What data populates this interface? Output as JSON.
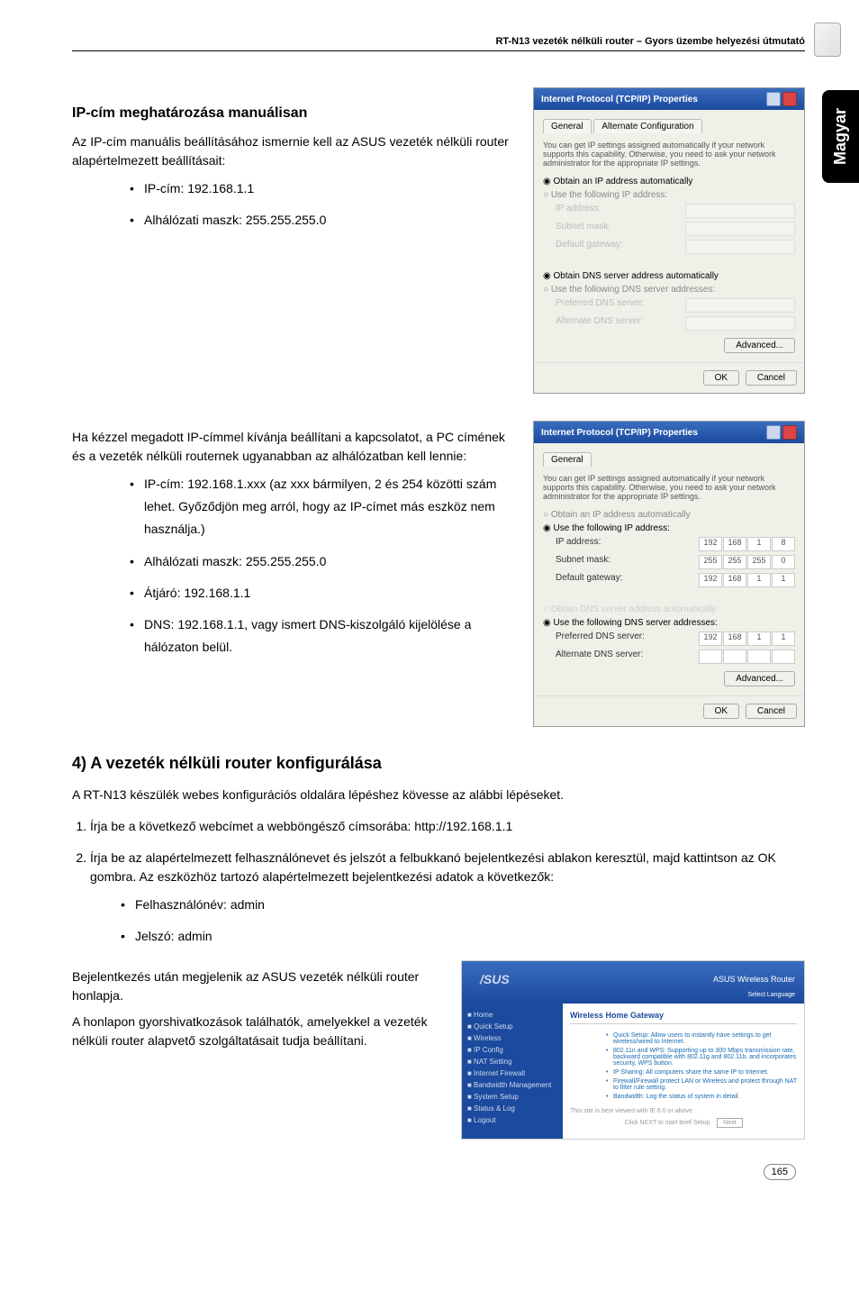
{
  "header": {
    "title": "RT-N13 vezeték nélküli router – Gyors üzembe helyezési útmutató"
  },
  "sideTab": "Magyar",
  "section1": {
    "heading": "IP-cím meghatározása manuálisan",
    "intro": "Az IP-cím manuális beállításához ismernie kell az ASUS vezeték nélküli router alapértelmezett beállításait:",
    "bullets": [
      "IP-cím: 192.168.1.1",
      "Alhálózati maszk: 255.255.255.0"
    ]
  },
  "dialog1": {
    "title": "Internet Protocol (TCP/IP) Properties",
    "tab1": "General",
    "tab2": "Alternate Configuration",
    "desc": "You can get IP settings assigned automatically if your network supports this capability. Otherwise, you need to ask your network administrator for the appropriate IP settings.",
    "radio1": "Obtain an IP address automatically",
    "radio2": "Use the following IP address:",
    "field1": "IP address:",
    "field2": "Subnet mask:",
    "field3": "Default gateway:",
    "radio3": "Obtain DNS server address automatically",
    "radio4": "Use the following DNS server addresses:",
    "field4": "Preferred DNS server:",
    "field5": "Alternate DNS server:",
    "btnAdv": "Advanced...",
    "btnOk": "OK",
    "btnCancel": "Cancel"
  },
  "section2": {
    "intro": "Ha kézzel megadott IP-címmel kívánja beállítani a kapcsolatot, a PC címének és a vezeték nélküli routernek ugyanabban az alhálózatban kell lennie:",
    "bullets": [
      "IP-cím: 192.168.1.xxx (az xxx bármilyen, 2 és 254 közötti szám lehet. Győződjön meg arról, hogy az IP-címet más eszköz nem használja.)",
      "Alhálózati maszk: 255.255.255.0",
      "Átjáró: 192.168.1.1",
      "DNS: 192.168.1.1, vagy ismert DNS-kiszolgáló kijelölése a hálózaton belül."
    ]
  },
  "dialog2": {
    "title": "Internet Protocol (TCP/IP) Properties",
    "tab1": "General",
    "desc": "You can get IP settings assigned automatically if your network supports this capability. Otherwise, you need to ask your network administrator for the appropriate IP settings.",
    "radio1": "Obtain an IP address automatically",
    "radio2": "Use the following IP address:",
    "field1": "IP address:",
    "val1a": "192",
    "val1b": "168",
    "val1c": "1",
    "val1d": "8",
    "field2": "Subnet mask:",
    "val2a": "255",
    "val2b": "255",
    "val2c": "255",
    "val2d": "0",
    "field3": "Default gateway:",
    "val3a": "192",
    "val3b": "168",
    "val3c": "1",
    "val3d": "1",
    "radio3": "Obtain DNS server address automatically",
    "radio4": "Use the following DNS server addresses:",
    "field4": "Preferred DNS server:",
    "val4a": "192",
    "val4b": "168",
    "val4c": "1",
    "val4d": "1",
    "field5": "Alternate DNS server:",
    "btnAdv": "Advanced...",
    "btnOk": "OK",
    "btnCancel": "Cancel"
  },
  "section3": {
    "heading": "4) A vezeték nélküli router konfigurálása",
    "intro": "A RT-N13 készülék webes konfigurációs oldalára lépéshez kövesse az alábbi lépéseket.",
    "steps": [
      "Írja be a következő webcímet a webböngésző címsorába: http://192.168.1.1",
      "Írja be az alapértelmezett felhasználónevet és jelszót a felbukkanó bejelentkezési ablakon keresztül, majd kattintson az OK gombra. Az eszközhöz tartozó alapértelmezett bejelentkezési adatok a következők:"
    ],
    "creds": [
      "Felhasználónév: admin",
      "Jelszó: admin"
    ],
    "para1": "Bejelentkezés után megjelenik az ASUS vezeték nélküli router honlapja.",
    "para2": "A honlapon gyorshivatkozások találhatók, amelyekkel a vezeték nélküli router alapvető szolgáltatásait tudja beállítani."
  },
  "router": {
    "brand": "/SUS",
    "headerText": "ASUS Wireless Router",
    "lang": "Select Language",
    "contentTitle": "Wireless Home Gateway",
    "items": [
      "Quick Setup: Allow users to instantly have settings to get wireless/wired to Internet.",
      "802.11n and WPS: Supporting up to 300 Mbps transmission rate, backward compatible with 802.11g and 802.11b, and incorporates security, WPS button.",
      "IP Sharing: All computers share the same IP to Internet.",
      "Firewall/Firewall protect LAN or Wireless and protect through NAT to filter rule setting.",
      "Bandwidth: Log the status of system in detail."
    ],
    "footerText": "This site is best viewed with IE 6.0 or above.",
    "nextLabel": "Click NEXT to start brief Setup.",
    "nextBtn": "Next"
  },
  "pageNum": "165"
}
